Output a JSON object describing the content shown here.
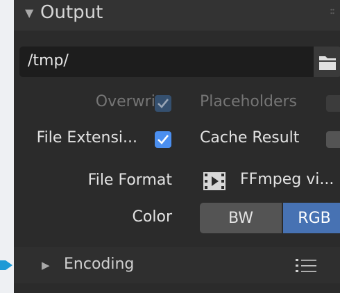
{
  "panel": {
    "title": "Output",
    "output_path": "/tmp/",
    "overwrite_label": "Overwrite",
    "overwrite_checked": true,
    "placeholders_label": "Placeholders",
    "placeholders_checked": false,
    "file_extension_label": "File Extensi...",
    "file_extension_checked": true,
    "cache_result_label": "Cache Result",
    "cache_result_checked": false,
    "file_format_label": "File Format",
    "file_format_value": "FFmpeg vi...",
    "color_label": "Color",
    "color_options": [
      "BW",
      "RGB"
    ],
    "color_selected": "RGB",
    "encoding_label": "Encoding"
  },
  "colors": {
    "panel_bg": "#2b2b2b",
    "accent": "#4772b3",
    "checkbox": "#4b8ff0",
    "pointer": "#1f9ad6"
  }
}
